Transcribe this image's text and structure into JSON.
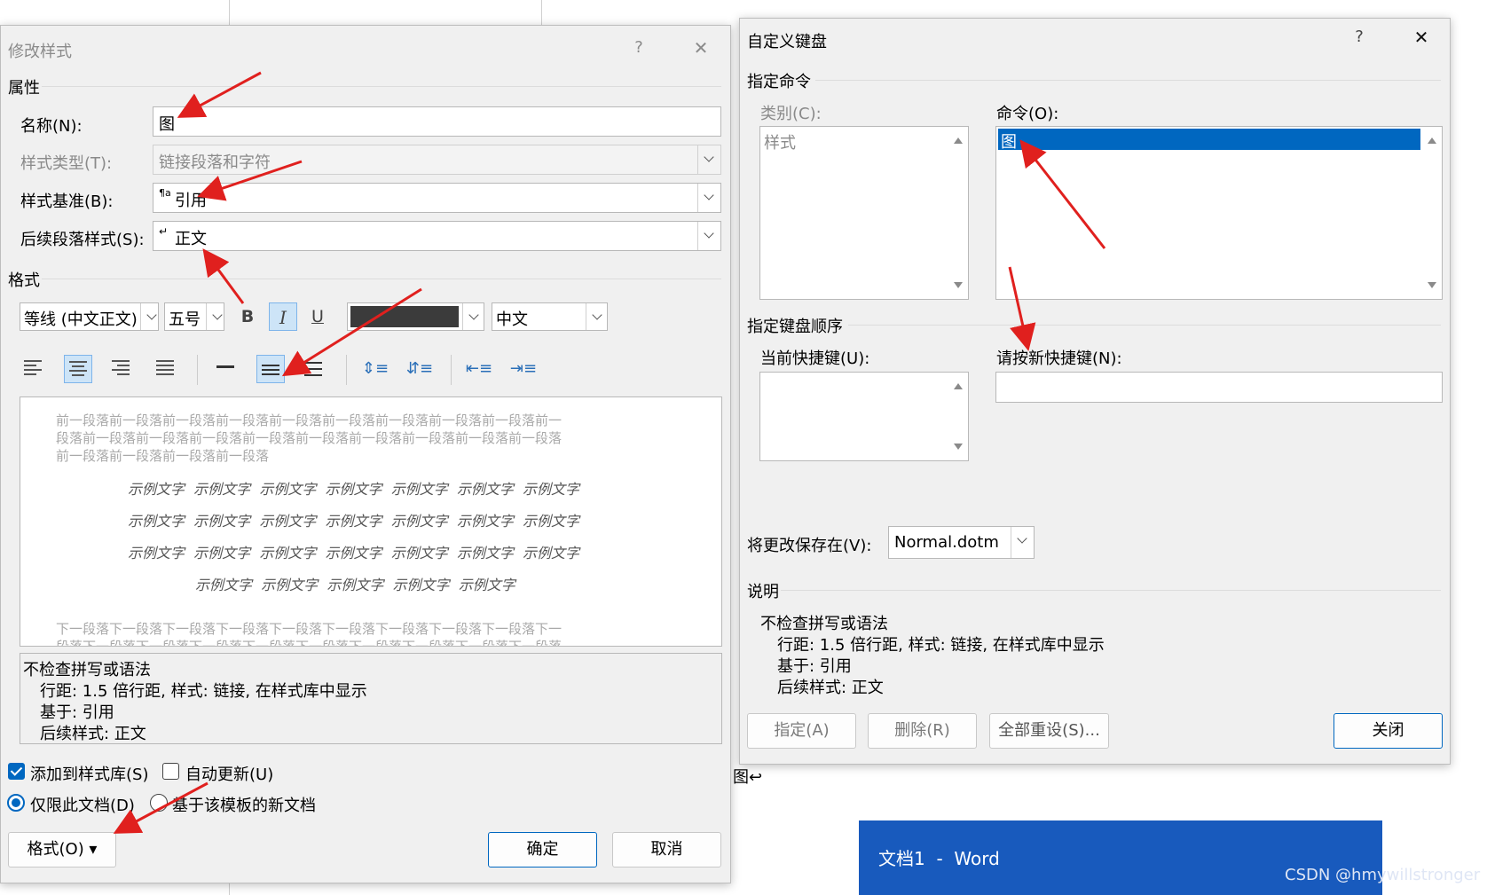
{
  "modify_style": {
    "title": "修改样式",
    "help_glyph": "?",
    "close_glyph": "✕",
    "properties_heading": "属性",
    "name_label": "名称(N):",
    "name_value": "图",
    "style_type_label": "样式类型(T):",
    "style_type_value": "链接段落和字符",
    "based_on_label": "样式基准(B):",
    "based_on_icon": "¶a",
    "based_on_value": "引用",
    "following_label": "后续段落样式(S):",
    "following_icon": "↵",
    "following_value": "正文",
    "format_heading": "格式",
    "font_value": "等线 (中文正文)",
    "size_value": "五号",
    "bold": "B",
    "italic": "I",
    "underline": "U",
    "language_value": "中文",
    "preview_prev": [
      "前一段落前一段落前一段落前一段落前一段落前一段落前一段落前一段落前一段落前一",
      "段落前一段落前一段落前一段落前一段落前一段落前一段落前一段落前一段落前一段落",
      "前一段落前一段落前一段落前一段落"
    ],
    "preview_sample": [
      "示例文字  示例文字  示例文字  示例文字  示例文字  示例文字  示例文字",
      "示例文字  示例文字  示例文字  示例文字  示例文字  示例文字  示例文字",
      "示例文字  示例文字  示例文字  示例文字  示例文字  示例文字  示例文字",
      "示例文字  示例文字  示例文字  示例文字  示例文字"
    ],
    "preview_next": [
      "下一段落下一段落下一段落下一段落下一段落下一段落下一段落下一段落下一段落下一",
      "段落下一段落下一段落下一段落下一段落下一段落下一段落下一段落下一段落下一段落"
    ],
    "description": [
      "不检查拼写或语法",
      "行距: 1.5 倍行距, 样式: 链接, 在样式库中显示",
      "基于: 引用",
      "后续样式: 正文"
    ],
    "add_to_gallery": "添加到样式库(S)",
    "auto_update": "自动更新(U)",
    "only_this_doc": "仅限此文档(D)",
    "new_docs_template": "基于该模板的新文档",
    "format_button": "格式(O) ▾",
    "ok_button": "确定",
    "cancel_button": "取消"
  },
  "customize_keyboard": {
    "title": "自定义键盘",
    "help_glyph": "?",
    "close_glyph": "✕",
    "specify_command_heading": "指定命令",
    "categories_label": "类别(C):",
    "categories_items": [
      "样式"
    ],
    "commands_label": "命令(O):",
    "commands_items": [
      "图"
    ],
    "key_sequence_heading": "指定键盘顺序",
    "current_keys_label": "当前快捷键(U):",
    "new_key_label": "请按新快捷键(N):",
    "new_key_value": "",
    "save_in_label": "将更改保存在(V):",
    "save_in_value": "Normal.dotm",
    "description_heading": "说明",
    "description": [
      "不检查拼写或语法",
      "行距: 1.5 倍行距, 样式: 链接, 在样式库中显示",
      "基于: 引用",
      "后续样式: 正文"
    ],
    "assign_button": "指定(A)",
    "remove_button": "删除(R)",
    "reset_all_button": "全部重设(S)...",
    "close_button": "关闭"
  },
  "background": {
    "taskbar_title": "文档1  -  Word",
    "doc_fragment": "图↩",
    "watermark": "CSDN @hmywillstronger"
  },
  "colors": {
    "accent": "#0067c0",
    "taskbar": "#185abd",
    "annotation_arrow": "#e0201e",
    "font_color_swatch": "#3b3b3b"
  }
}
